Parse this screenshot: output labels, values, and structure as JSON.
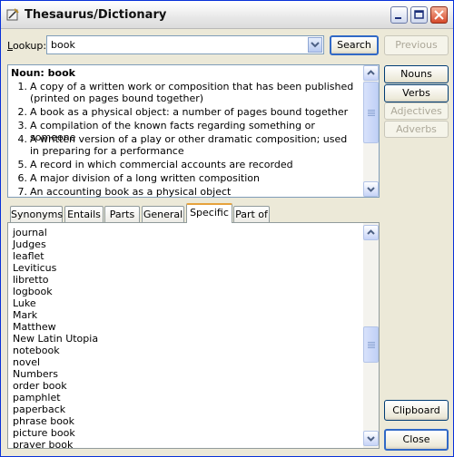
{
  "window": {
    "title": "Thesaurus/Dictionary"
  },
  "lookup": {
    "label": "Lookup:",
    "value": "book",
    "search_label": "Search",
    "previous_label": "Previous"
  },
  "side": {
    "nouns": "Nouns",
    "verbs": "Verbs",
    "adjectives": "Adjectives",
    "adverbs": "Adverbs",
    "clipboard": "Clipboard",
    "close": "Close"
  },
  "definitions": {
    "heading": "Noun: book",
    "items": [
      {
        "num": "1.",
        "text": "A copy of a written work or composition that has been published (printed on pages bound together)"
      },
      {
        "num": "2.",
        "text": "A book as a physical object: a number of pages bound together"
      },
      {
        "num": "3.",
        "text": "A compilation of the known facts regarding something or someone"
      },
      {
        "num": "4.",
        "text": "A written version of a play or other dramatic composition; used in preparing for a performance"
      },
      {
        "num": "5.",
        "text": "A record in which commercial accounts are recorded"
      },
      {
        "num": "6.",
        "text": "A major division of a long written composition"
      },
      {
        "num": "7.",
        "text": "An accounting book as a physical object"
      }
    ]
  },
  "tabs": [
    "Synonyms",
    "Entails",
    "Parts",
    "General",
    "Specific",
    "Part of"
  ],
  "active_tab": "Specific",
  "words": [
    "journal",
    "Judges",
    "leaflet",
    "Leviticus",
    "libretto",
    "logbook",
    "Luke",
    "Mark",
    "Matthew",
    "New Latin Utopia",
    "notebook",
    "novel",
    "Numbers",
    "order book",
    "pamphlet",
    "paperback",
    "phrase book",
    "picture book",
    "prayer book"
  ]
}
